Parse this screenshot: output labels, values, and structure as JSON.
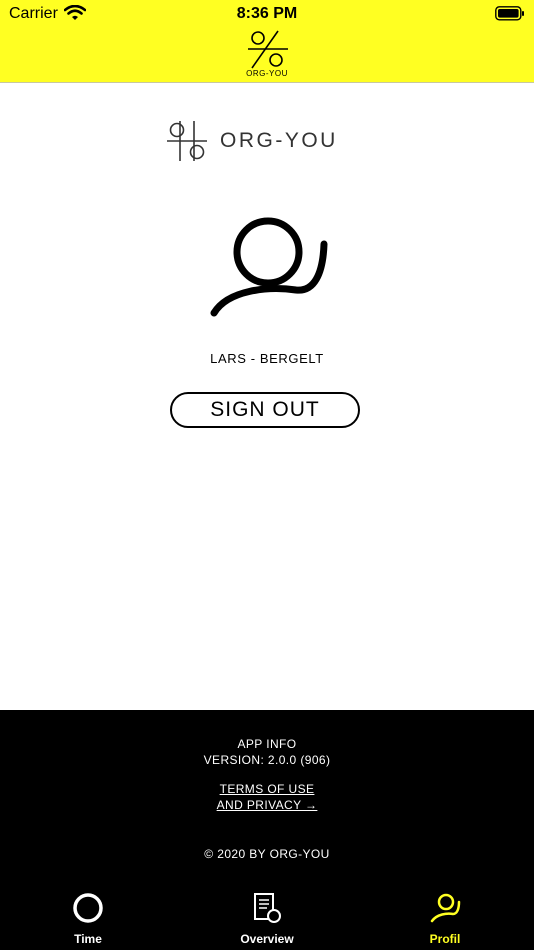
{
  "status_bar": {
    "carrier": "Carrier",
    "time": "8:36 PM"
  },
  "nav": {
    "logo_text": "ORG-YOU"
  },
  "brand": {
    "name": "ORG-YOU"
  },
  "profile": {
    "user_name": "LARS - BERGELT",
    "sign_out_label": "SIGN OUT"
  },
  "footer": {
    "app_info": "APP INFO",
    "version": "VERSION: 2.0.0 (906)",
    "terms_line1": "TERMS OF USE",
    "terms_line2": "AND PRIVACY →",
    "copyright": "© 2020 BY ORG-YOU"
  },
  "tabs": [
    {
      "label": "Time",
      "icon": "circle-icon",
      "active": false
    },
    {
      "label": "Overview",
      "icon": "document-icon",
      "active": false
    },
    {
      "label": "Profil",
      "icon": "profile-icon",
      "active": true
    }
  ],
  "colors": {
    "accent": "#ffff22",
    "footer_bg": "#000000",
    "text": "#000000"
  }
}
